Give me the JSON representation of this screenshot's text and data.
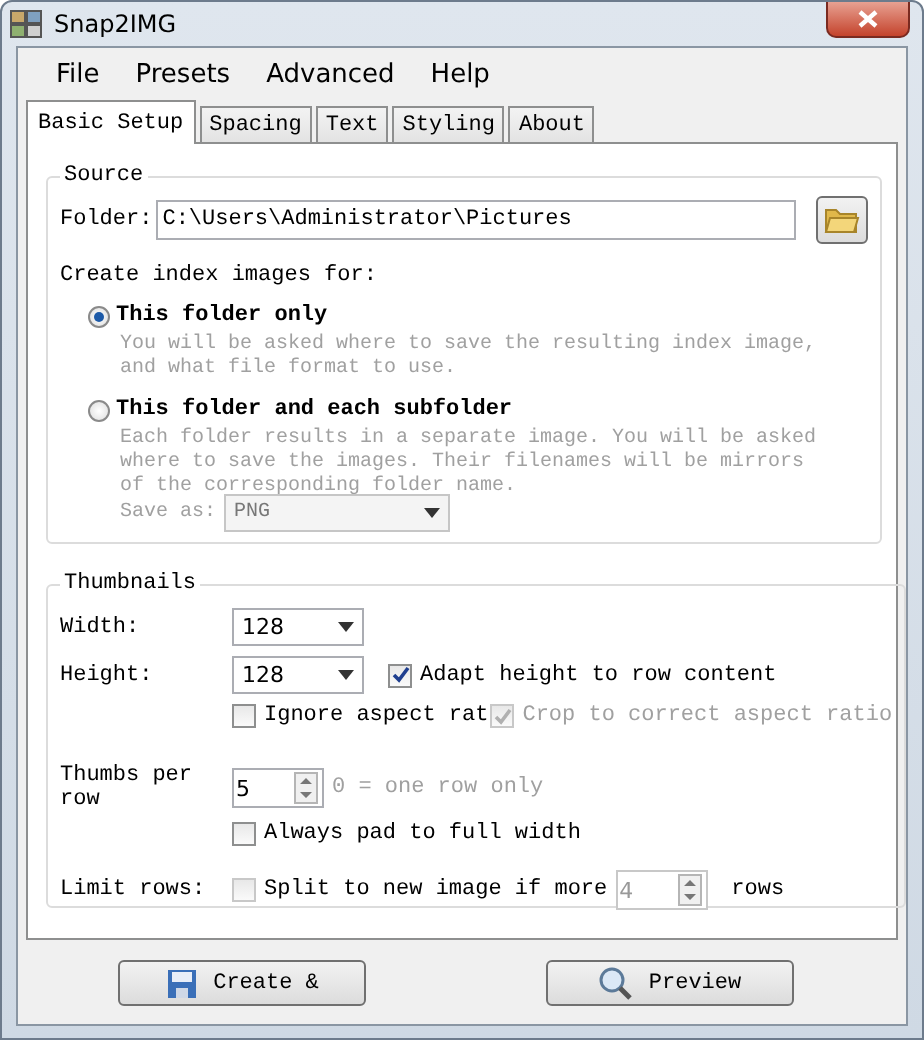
{
  "window": {
    "title": "Snap2IMG"
  },
  "menu": [
    "File",
    "Presets",
    "Advanced",
    "Help"
  ],
  "tabs": [
    {
      "label": "Basic Setup",
      "selected": true
    },
    {
      "label": "Spacing",
      "selected": false
    },
    {
      "label": "Text",
      "selected": false
    },
    {
      "label": "Styling",
      "selected": false
    },
    {
      "label": "About",
      "selected": false
    }
  ],
  "source": {
    "title": "Source",
    "folder_label": "Folder:",
    "folder_value": "C:\\Users\\Administrator\\Pictures",
    "create_label": "Create index images for:",
    "options": [
      {
        "label": "This folder only",
        "selected": true,
        "description": [
          "You will be asked where to save the resulting index image,",
          "and what file format to use."
        ]
      },
      {
        "label": "This folder and each subfolder",
        "selected": false,
        "description": [
          "Each folder results in a separate image. You will be asked",
          "where to save the images. Their filenames will be mirrors",
          "of the corresponding folder name."
        ]
      }
    ],
    "save_as": {
      "label": "Save as:",
      "value": "PNG",
      "disabled": true
    }
  },
  "thumbnails": {
    "title": "Thumbnails",
    "width": {
      "label": "Width:",
      "value": "128"
    },
    "height": {
      "label": "Height:",
      "value": "128"
    },
    "adapt": {
      "label": "Adapt height to row content",
      "checked": true,
      "disabled": false
    },
    "ignore_aspect": {
      "label": "Ignore aspect rat",
      "checked": false,
      "disabled": false
    },
    "crop": {
      "label": "Crop to correct aspect ratio",
      "checked": true,
      "disabled": true
    },
    "thumbs_per_row": {
      "label": "Thumbs per row",
      "value": "5",
      "hint": "0 = one row only",
      "disabled": false
    },
    "pad": {
      "label": "Always pad to full width",
      "checked": false,
      "disabled": false
    },
    "limit": {
      "label": "Limit rows:",
      "check_label": "Split to new image if more",
      "checked": false,
      "value": "4",
      "disabled": true,
      "unit": "rows"
    }
  },
  "buttons": [
    {
      "label": "Create &",
      "kind": "save"
    },
    {
      "label": "Preview",
      "kind": "search"
    }
  ]
}
